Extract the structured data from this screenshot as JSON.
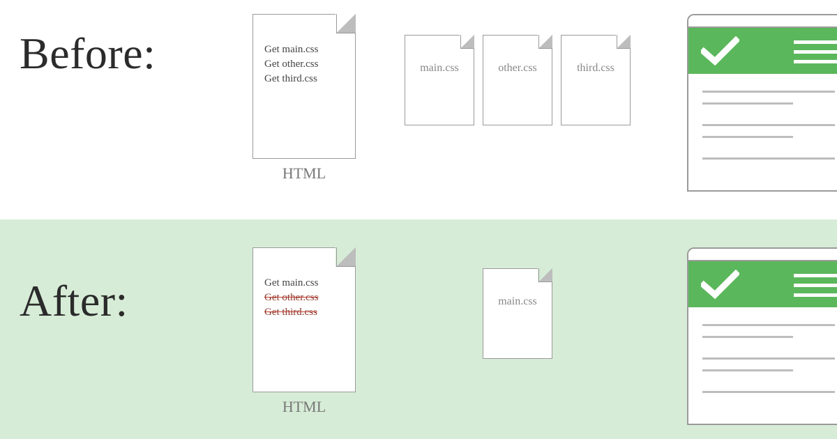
{
  "before": {
    "heading": "Before:",
    "html_doc": {
      "lines": [
        "Get main.css",
        "Get other.css",
        "Get third.css"
      ],
      "label": "HTML"
    },
    "css_files": [
      "main.css",
      "other.css",
      "third.css"
    ]
  },
  "after": {
    "heading": "After:",
    "html_doc": {
      "lines": [
        {
          "text": "Get main.css",
          "struck": false
        },
        {
          "text": "Get other.css",
          "struck": true
        },
        {
          "text": "Get third.css",
          "struck": true
        }
      ],
      "label": "HTML"
    },
    "css_files": [
      "main.css"
    ]
  },
  "colors": {
    "accent_green": "#5bb75b",
    "after_bg": "#d7ecd7",
    "stroke": "#9a9a9a"
  }
}
